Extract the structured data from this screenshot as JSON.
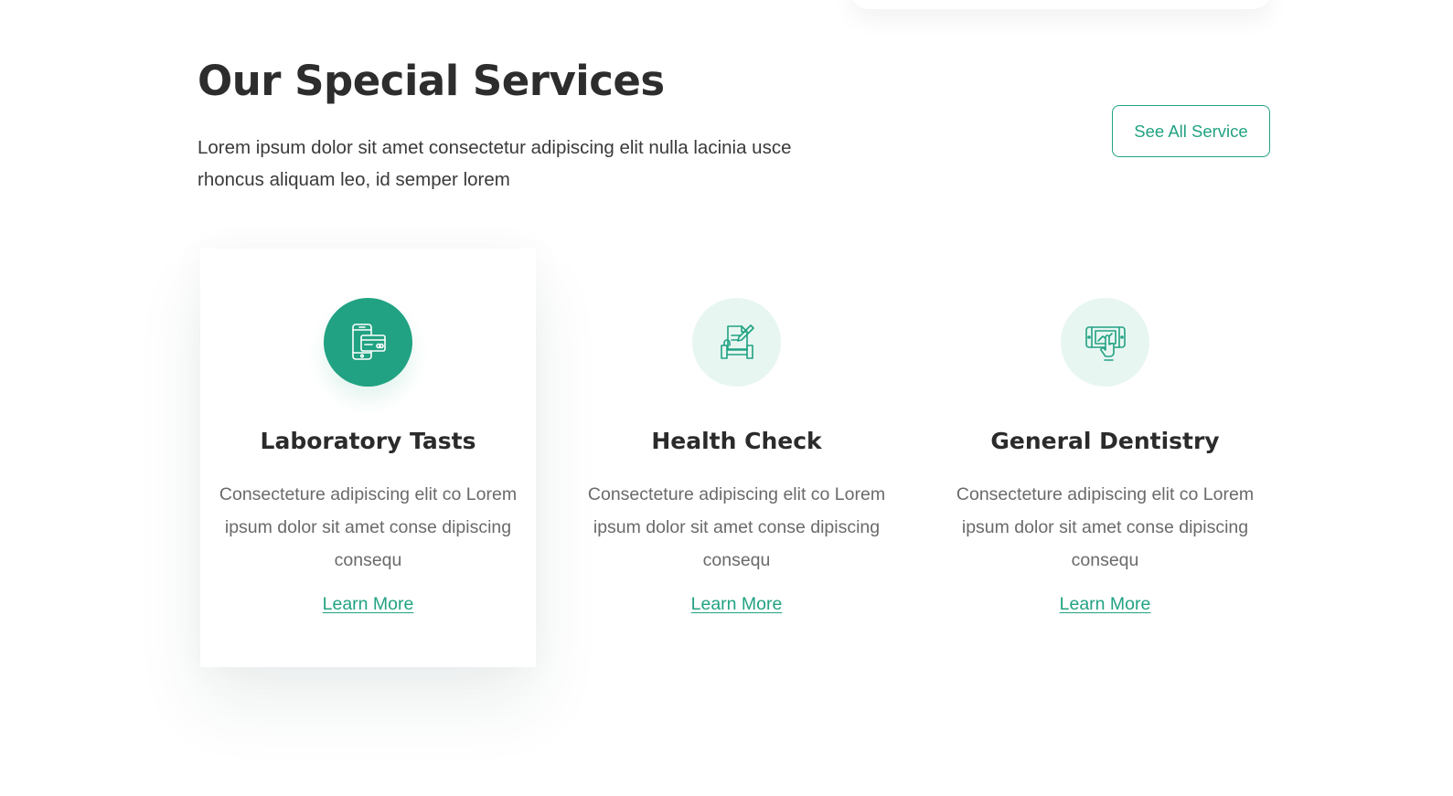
{
  "header": {
    "title": "Our Special Services",
    "description": "Lorem ipsum dolor sit amet consectetur adipiscing elit nulla lacinia usce rhoncus aliquam leo, id semper lorem",
    "see_all_label": "See All Service"
  },
  "colors": {
    "accent": "#21a282",
    "accent_light": "#e8f6f2",
    "title": "#2d2d2d",
    "body_text": "#6a6a6a"
  },
  "services": [
    {
      "title": "Laboratory Tasts",
      "text": "Consecteture adipiscing elit co Lorem ipsum dolor sit amet conse dipiscing consequ",
      "link": "Learn More",
      "icon": "mobile-payment-icon",
      "active": true
    },
    {
      "title": "Health Check",
      "text": "Consecteture adipiscing elit co Lorem ipsum dolor sit amet conse dipiscing consequ",
      "link": "Learn More",
      "icon": "document-edit-icon",
      "active": false
    },
    {
      "title": "General Dentistry",
      "text": "Consecteture adipiscing elit co Lorem ipsum dolor sit amet conse dipiscing consequ",
      "link": "Learn More",
      "icon": "touch-screen-icon",
      "active": false
    }
  ]
}
